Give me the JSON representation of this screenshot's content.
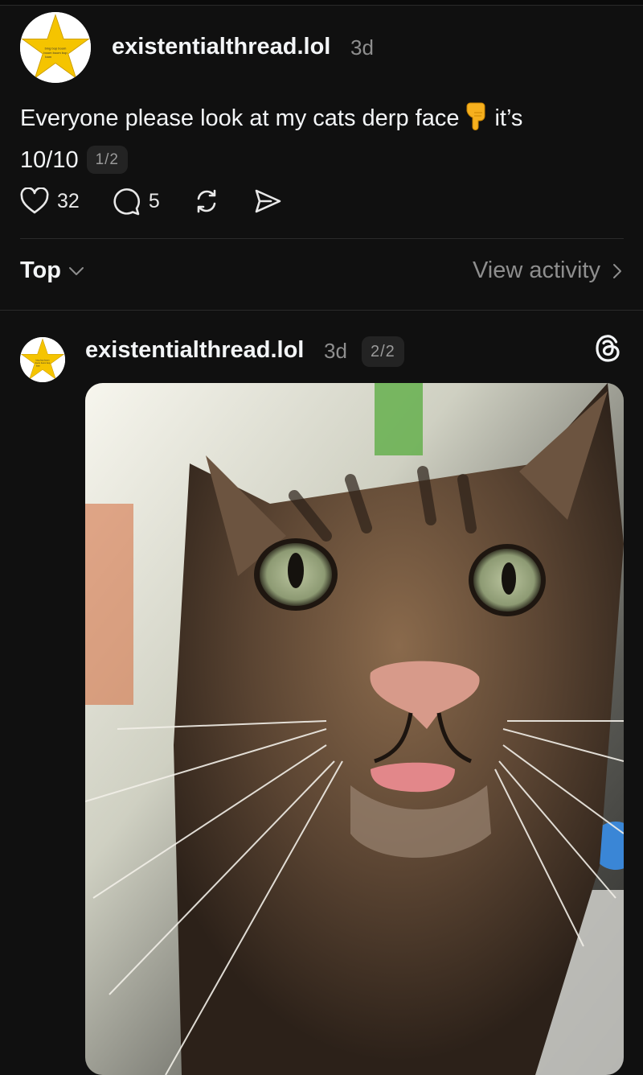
{
  "post": {
    "username": "existentialthread.lol",
    "time": "3d",
    "text_before_emoji": "Everyone please look at my cats derp face",
    "text_after_emoji": "it’s",
    "text_line2": "10/10",
    "page_indicator": "1/2",
    "avatar_text": [
      "bing bop boom",
      "boom boom bop",
      "bam"
    ],
    "likes": "32",
    "comments": "5"
  },
  "sort_bar": {
    "sort_label": "Top",
    "view_activity_label": "View activity"
  },
  "reply": {
    "username": "existentialthread.lol",
    "time": "3d",
    "page_indicator": "2/2",
    "avatar_text": [
      "bing bop boom",
      "boom boom bop",
      "bam"
    ]
  },
  "icons": {
    "like": "heart-icon",
    "comment": "comment-bubble-icon",
    "repost": "repost-icon",
    "share": "send-icon",
    "sort": "chevron-down-icon",
    "view_activity": "chevron-right-icon",
    "brand": "threads-logo-icon"
  },
  "colors": {
    "background": "#101010",
    "text": "#f3f5f7",
    "muted": "#8e8e8e",
    "avatar_star": "#f5c400"
  }
}
